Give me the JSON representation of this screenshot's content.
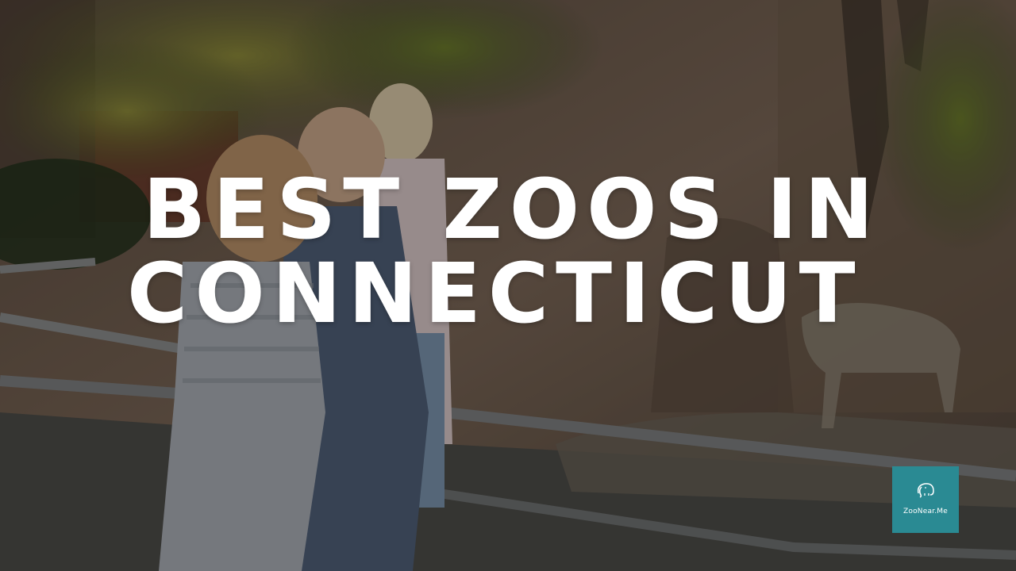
{
  "headline": {
    "line1": "BEST ZOOS IN",
    "line2": "CONNECTICUT"
  },
  "badge": {
    "text": "ZooNear.Me",
    "icon": "elephant-logo-icon",
    "color": "#2a8a93"
  },
  "photo": {
    "subject": "family-at-zoo-railing-photo"
  }
}
